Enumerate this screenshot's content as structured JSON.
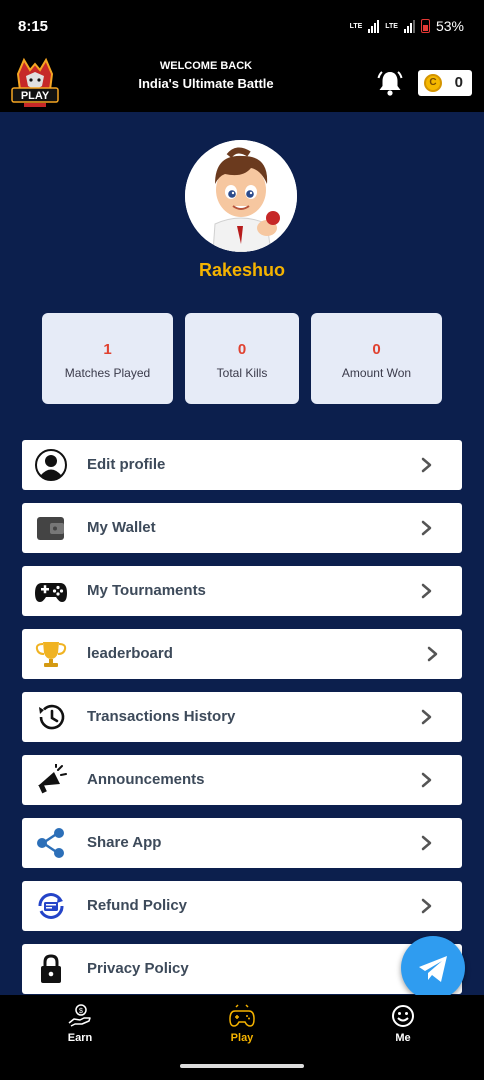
{
  "status_bar": {
    "time": "8:15",
    "network_1": "LTE",
    "network_2": "LTE",
    "battery_percent": "53%"
  },
  "header": {
    "logo_text": "PLAY",
    "welcome_line1": "WELCOME BACK",
    "welcome_line2": "India's Ultimate Battle",
    "coin_symbol": "C",
    "coin_count": "0"
  },
  "profile": {
    "username": "Rakeshuo"
  },
  "stats": [
    {
      "value": "1",
      "label": "Matches Played"
    },
    {
      "value": "0",
      "label": "Total Kills"
    },
    {
      "value": "0",
      "label": "Amount Won"
    }
  ],
  "menu": [
    {
      "label": "Edit profile",
      "icon": "user-silhouette-icon"
    },
    {
      "label": "My Wallet",
      "icon": "wallet-icon"
    },
    {
      "label": "My Tournaments",
      "icon": "gamepad-icon"
    },
    {
      "label": "leaderboard",
      "icon": "trophy-icon"
    },
    {
      "label": "Transactions History",
      "icon": "history-icon"
    },
    {
      "label": "Announcements",
      "icon": "megaphone-icon"
    },
    {
      "label": "Share App",
      "icon": "share-icon"
    },
    {
      "label": "Refund Policy",
      "icon": "refund-icon"
    },
    {
      "label": "Privacy Policy",
      "icon": "lock-icon"
    }
  ],
  "bottom_nav": [
    {
      "label": "Earn",
      "icon": "earn-hand-coin-icon",
      "active": false
    },
    {
      "label": "Play",
      "icon": "gamepad-icon",
      "active": true
    },
    {
      "label": "Me",
      "icon": "smiley-icon",
      "active": false
    }
  ],
  "colors": {
    "background": "#0c1f4d",
    "accent_gold": "#f5b300",
    "stat_value": "#e04130",
    "fab": "#2f9cf0"
  }
}
